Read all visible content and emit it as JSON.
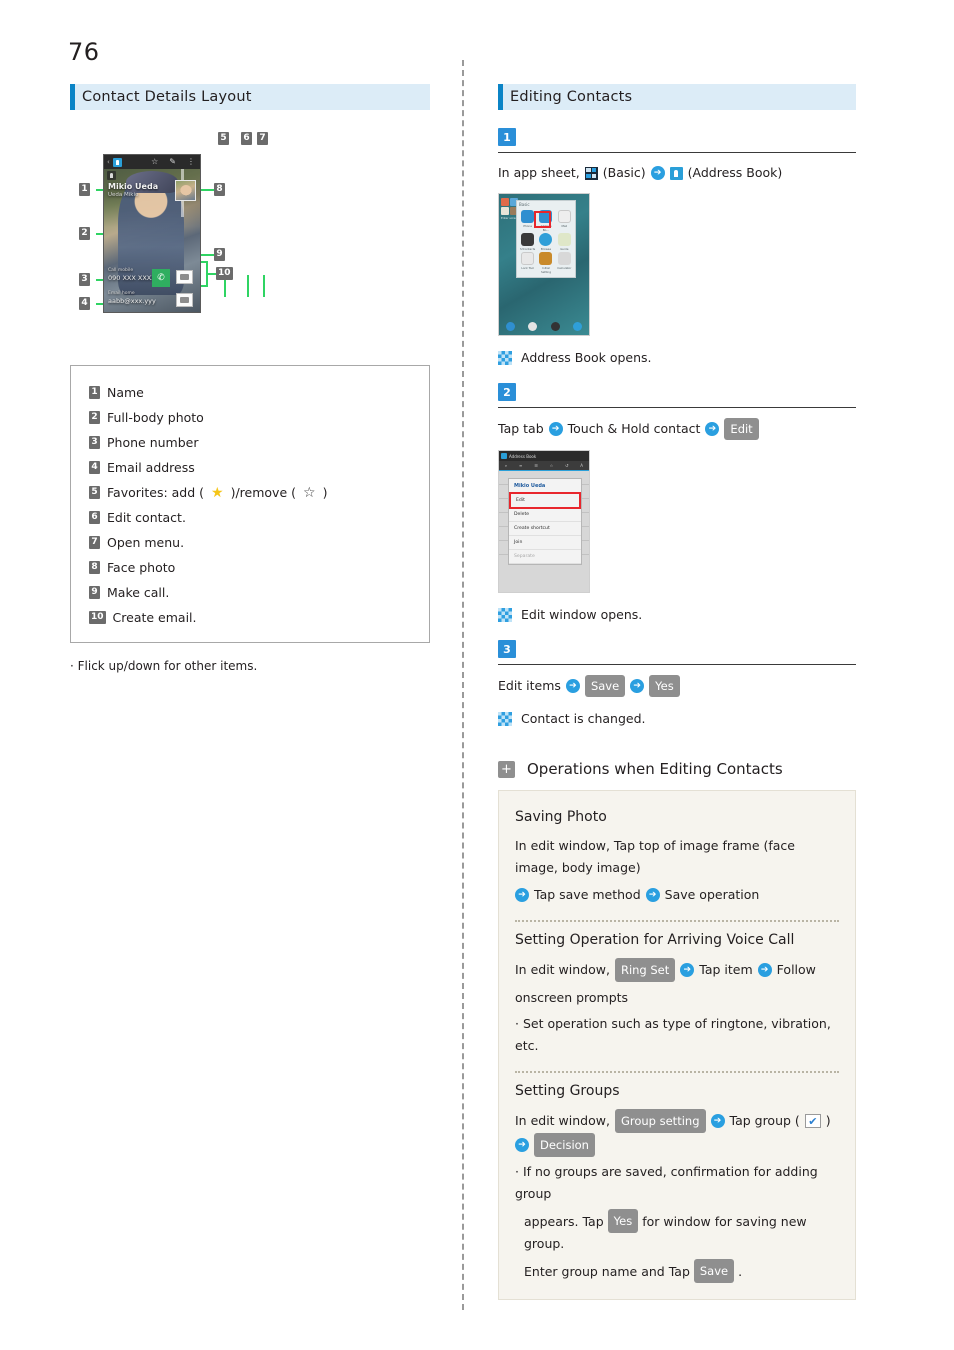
{
  "page": {
    "number": "76"
  },
  "left": {
    "heading": "Contact Details Layout",
    "mock": {
      "contact_name": "Mikio Ueda",
      "contact_name_sub": "Ueda Mikio",
      "phone_label": "Call mobile",
      "phone_value": "090 XXX XXXXX",
      "email_label": "Email home",
      "email_value": "aabb@xxx.yyy",
      "icon_star": "☆",
      "icon_edit": "✎",
      "icon_menu": "⋮",
      "icon_back": "‹",
      "icon_call": "✆",
      "callouts": [
        "1",
        "2",
        "3",
        "4",
        "5",
        "6",
        "7",
        "8",
        "9",
        "10"
      ]
    },
    "legend": [
      {
        "num": "1",
        "text": "Name"
      },
      {
        "num": "2",
        "text": "Full-body photo"
      },
      {
        "num": "3",
        "text": "Phone number"
      },
      {
        "num": "4",
        "text": "Email address"
      },
      {
        "num": "5",
        "text": "Favorites: add (",
        "text2": ")/remove (",
        "text3": ")",
        "star_filled": "★",
        "star_outline": "☆"
      },
      {
        "num": "6",
        "text": "Edit contact."
      },
      {
        "num": "7",
        "text": "Open menu."
      },
      {
        "num": "8",
        "text": "Face photo"
      },
      {
        "num": "9",
        "text": "Make call."
      },
      {
        "num": "10",
        "text": "Create email."
      }
    ],
    "note": "· Flick up/down for other items."
  },
  "right": {
    "heading": "Editing Contacts",
    "steps": [
      {
        "num": "1",
        "line": {
          "pre": "In app sheet,",
          "label1": "(Basic)",
          "label2": "(Address Book)"
        },
        "shot": {
          "sheet_title": "Basic",
          "apps": [
            "Phone",
            "Address Bo…",
            "Mail",
            "S!Contacts",
            "Browse",
            "Guide",
            "Lock Tool",
            "Initial Setting",
            "Calculator"
          ]
        },
        "result": "Address Book opens."
      },
      {
        "num": "2",
        "line": {
          "pre": "Tap tab",
          "mid": "Touch & Hold contact",
          "key": "Edit"
        },
        "shot": {
          "title": "Address Book",
          "menu_header": "Mikio Ueda",
          "menu_items": [
            "Edit",
            "Delete",
            "Create shortcut",
            "Join",
            "Separate"
          ]
        },
        "result": "Edit window opens."
      },
      {
        "num": "3",
        "line": {
          "pre": "Edit items",
          "key1": "Save",
          "key2": "Yes"
        },
        "result": "Contact is changed."
      }
    ],
    "operations": {
      "title": "Operations when Editing Contacts",
      "plus": "+",
      "sections": [
        {
          "title": "Saving Photo",
          "body_pre": "In edit window, Tap top of image frame (face image, body image)",
          "body_mid": "Tap save method",
          "body_end": "Save operation"
        },
        {
          "title": "Setting Operation for Arriving Voice Call",
          "body_pre": "In edit window,",
          "key": "Ring Set",
          "body_mid": "Tap item",
          "body_end": "Follow",
          "body_wrap": "onscreen prompts",
          "bullet": "· Set operation such as type of ringtone, vibration, etc."
        },
        {
          "title": "Setting Groups",
          "body_pre": "In edit window,",
          "key": "Group setting",
          "body_mid": "Tap group (",
          "body_mid2": ")",
          "key2": "Decision",
          "check": "✔",
          "bullet_a": "· If no groups are saved, confirmation for adding group",
          "bullet_b_pre": "appears. Tap",
          "bullet_b_key": "Yes",
          "bullet_b_post": "for window for saving new group.",
          "bullet_c_pre": "Enter group name and Tap",
          "bullet_c_key": "Save",
          "bullet_c_post": "."
        }
      ]
    }
  },
  "colors": {
    "accent": "#2a8fd8",
    "headband": "#dcecf7",
    "badge": "#6b6b6b",
    "key": "#8f8f8f",
    "leader": "#2fd463"
  }
}
